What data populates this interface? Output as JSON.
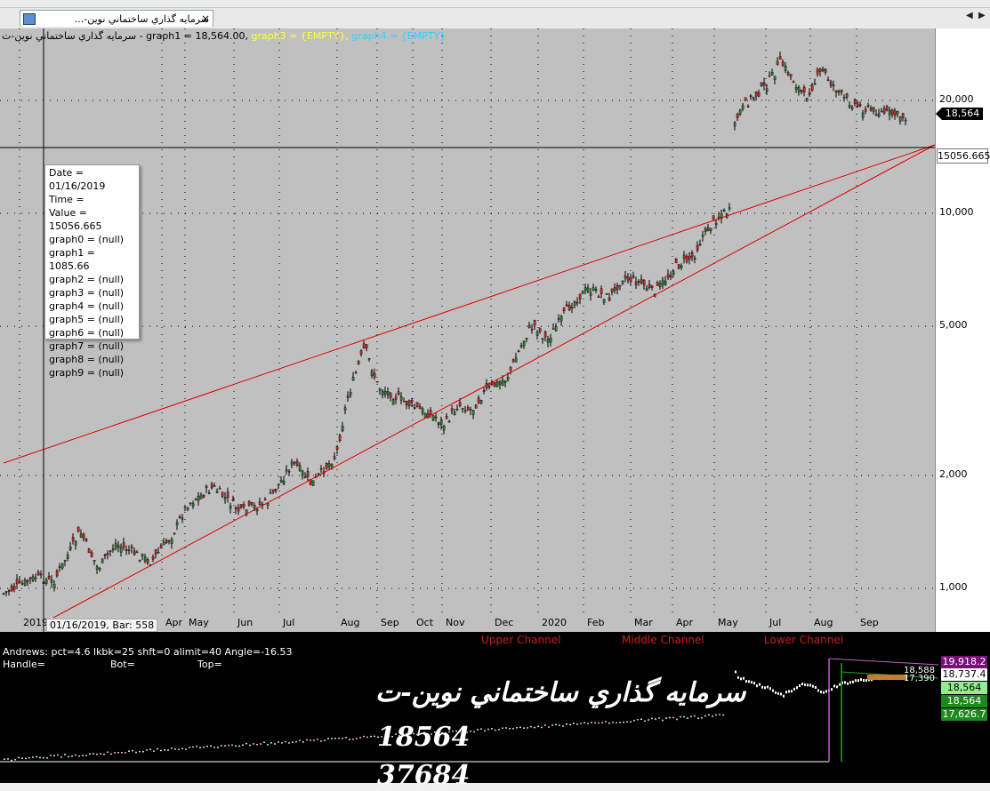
{
  "tab": {
    "title": "سرمايه گذاري ساختماني نوين-...",
    "close": "×"
  },
  "tab_nav": {
    "prev": "◀",
    "next": "▶"
  },
  "header": {
    "prefix": "سرمايه گذاري ساختماني نوين-ت - graph1 = 18,564.00, ",
    "graph3": "graph3 = {EMPTY},",
    "graph4": " graph4 = {EMPTY}"
  },
  "y_axis": {
    "scale": "log",
    "ticks": [
      {
        "label": "20,000",
        "value": 20000
      },
      {
        "label": "10,000",
        "value": 10000
      },
      {
        "label": "5,000",
        "value": 5000
      },
      {
        "label": "2,000",
        "value": 2000
      },
      {
        "label": "1,000",
        "value": 1000
      }
    ]
  },
  "x_axis": {
    "labels": [
      "2019",
      "Apr",
      "May",
      "Jun",
      "Jul",
      "Aug",
      "Sep",
      "Oct",
      "Nov",
      "Dec",
      "2020",
      "Feb",
      "Mar",
      "Apr",
      "May",
      "Jul",
      "Aug",
      "Sep"
    ]
  },
  "last_price": "18,564",
  "crosshair_value": "15056.665",
  "tooltip": {
    "lines": [
      "Date = 01/16/2019",
      "Time =",
      "Value = 15056.665",
      "graph0 = (null)",
      "graph1 = 1085.66",
      "graph2 = (null)",
      "graph3 = (null)",
      "graph4 = (null)",
      "graph5 = (null)",
      "graph6 = (null)",
      "graph7 = (null)",
      "graph8 = (null)",
      "graph9 = (null)"
    ]
  },
  "bar_info": "01/16/2019, Bar: 558",
  "lower_panel": {
    "andrews": "Andrews: pct=4.6 lkbk=25 shft=0 alimit=40 Angle=-16.53",
    "handle": "Handle=",
    "bot": "Bot=",
    "top": "Top=",
    "upper_channel": "Upper Channel",
    "middle_channel": "Middle Channel",
    "lower_channel": "Lower Channel",
    "symbol_name": "سرمايه گذاري ساختماني نوين-ت",
    "price_big": "18564",
    "volume_big": "37684",
    "overlap_label": "18,588",
    "overlap_label2": "17,390",
    "tags": [
      {
        "label": "19,918.2",
        "bg": "#7a0f7a",
        "fg": "#ffffff"
      },
      {
        "label": "18,737.4",
        "bg": "#ffffff",
        "fg": "#000000"
      },
      {
        "label": "18,564",
        "bg": "#90ee90",
        "fg": "#000000"
      },
      {
        "label": "18,564",
        "bg": "#1e8a1e",
        "fg": "#ffffff"
      },
      {
        "label": "17,626.7",
        "bg": "#1e8a1e",
        "fg": "#ffffff"
      }
    ]
  },
  "colors": {
    "up": "#2e7d32",
    "down": "#c62828",
    "channel": "#e00000",
    "chart_bg": "#c0c0c0"
  }
}
